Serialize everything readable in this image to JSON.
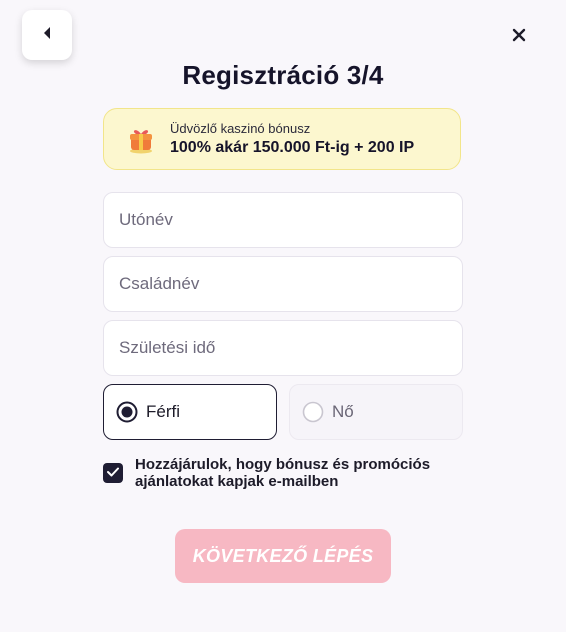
{
  "header": {
    "title": "Regisztráció 3/4"
  },
  "bonus": {
    "subtitle": "Üdvözlő kaszinó bónusz",
    "offer": "100% akár 150.000 Ft-ig + 200 IP",
    "icon": "gift-icon"
  },
  "form": {
    "first_name": {
      "placeholder": "Utónév",
      "value": ""
    },
    "last_name": {
      "placeholder": "Családnév",
      "value": ""
    },
    "birth_date": {
      "placeholder": "Születési idő",
      "value": ""
    }
  },
  "gender": {
    "options": [
      {
        "label": "Férfi",
        "selected": true
      },
      {
        "label": "Nő",
        "selected": false
      }
    ]
  },
  "consent": {
    "checked": true,
    "text": "Hozzájárulok, hogy bónusz és promóciós ajánlatokat kapjak e-mailben"
  },
  "actions": {
    "next_label": "KÖVETKEZŐ LÉPÉS"
  },
  "colors": {
    "accent_dark": "#1f1d33",
    "button_disabled": "#f7b8c3",
    "bonus_bg": "#fcf7cf"
  }
}
